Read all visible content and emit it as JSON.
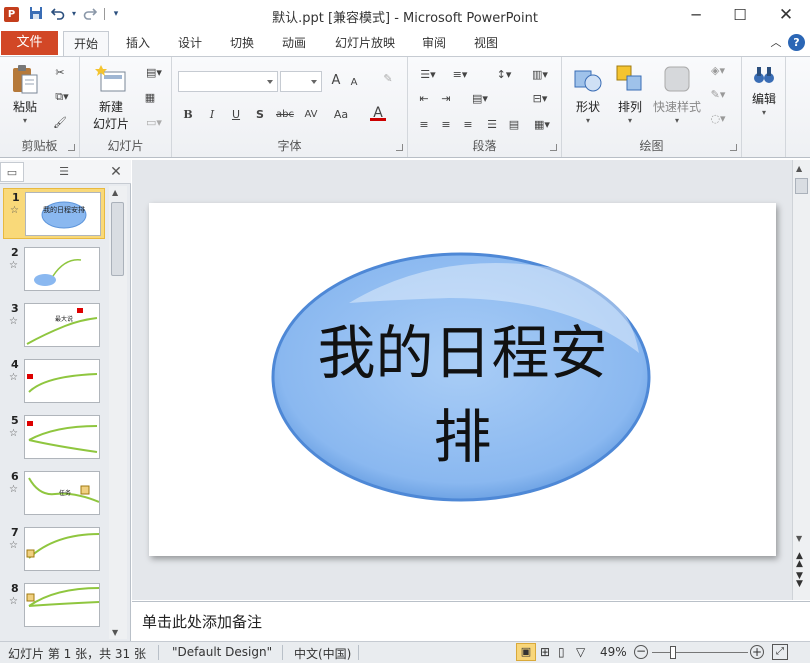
{
  "titlebar": {
    "title": "默认.ppt [兼容模式] - Microsoft PowerPoint",
    "app_icon": "P",
    "qat": [
      "save-icon",
      "undo-icon",
      "redo-icon",
      "customize-icon"
    ]
  },
  "tabs": {
    "file": "文件",
    "items": [
      "开始",
      "插入",
      "设计",
      "切换",
      "动画",
      "幻灯片放映",
      "审阅",
      "视图"
    ],
    "active": "开始"
  },
  "ribbon": {
    "clipboard": {
      "label": "剪贴板",
      "paste": "粘贴"
    },
    "slides": {
      "label": "幻灯片",
      "new_slide_1": "新建",
      "new_slide_2": "幻灯片"
    },
    "font": {
      "label": "字体",
      "bold": "B",
      "italic": "I",
      "underline": "U",
      "shadow": "S",
      "strike": "abc",
      "spacing": "AV",
      "case": "Aa",
      "color": "A",
      "grow": "A",
      "shrink": "A"
    },
    "paragraph": {
      "label": "段落"
    },
    "drawing": {
      "label": "绘图",
      "shapes": "形状",
      "arrange": "排列",
      "quick_styles": "快速样式"
    },
    "editing": {
      "label": "编辑"
    }
  },
  "slides_panel": {
    "items": [
      {
        "num": "1",
        "title": "我的日程安排"
      },
      {
        "num": "2"
      },
      {
        "num": "3"
      },
      {
        "num": "4"
      },
      {
        "num": "5"
      },
      {
        "num": "6"
      },
      {
        "num": "7"
      },
      {
        "num": "8"
      }
    ],
    "selected": "1",
    "thumb_text_3": "最大说",
    "thumb_text_6": "任务"
  },
  "slide": {
    "title_line1": "我的日程安",
    "title_line2": "排"
  },
  "notes": {
    "placeholder": "单击此处添加备注"
  },
  "statusbar": {
    "slide_info": "幻灯片 第 1 张，共 31 张",
    "theme": "\"Default Design\"",
    "language": "中文(中国)",
    "zoom": "49%"
  },
  "colors": {
    "file_tab": "#d24726",
    "ellipse": "#8ab8f0",
    "accent": "#2b579a"
  }
}
